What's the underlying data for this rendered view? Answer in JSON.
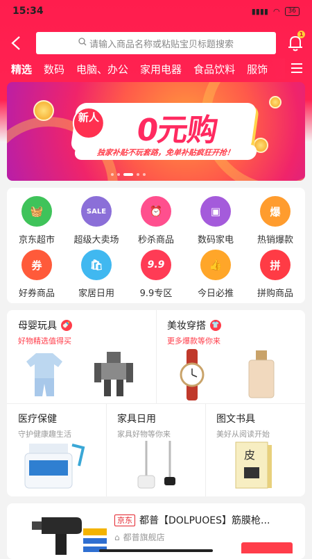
{
  "status": {
    "time": "15:34",
    "battery": "36"
  },
  "search": {
    "placeholder": "请输入商品名称或粘贴宝贝标题搜索",
    "notification_count": "1"
  },
  "tabs": [
    "精选",
    "数码",
    "电脑、办公",
    "家用电器",
    "食品饮料",
    "服饰"
  ],
  "banner": {
    "badge": "新人",
    "title": "0元购",
    "subtitle": "独家补贴不玩套路，免单补贴疯狂开抢！"
  },
  "categories": [
    {
      "label": "京东超市",
      "glyph": "🧺",
      "color": "#3fc35a"
    },
    {
      "label": "超级大卖场",
      "glyph": "SALE",
      "color": "#8b6fd8"
    },
    {
      "label": "秒杀商品",
      "glyph": "⏰",
      "color": "#ff4f8e"
    },
    {
      "label": "数码家电",
      "glyph": "▣",
      "color": "#a45bdb"
    },
    {
      "label": "热销爆款",
      "glyph": "爆",
      "color": "#ff9c2e"
    },
    {
      "label": "好券商品",
      "glyph": "券",
      "color": "#ff5a3a"
    },
    {
      "label": "家居日用",
      "glyph": "🛍",
      "color": "#40b8f0"
    },
    {
      "label": "9.9专区",
      "glyph": "9.9",
      "color": "#ff3b55"
    },
    {
      "label": "今日必推",
      "glyph": "👍",
      "color": "#ffa629"
    },
    {
      "label": "拼购商品",
      "glyph": "拼",
      "color": "#ff3b45"
    }
  ],
  "promos": {
    "baby": {
      "title": "母婴玩具",
      "subtitle": "好物精选值得买"
    },
    "beauty": {
      "title": "美妆穿搭",
      "subtitle": "更多爆款等你来"
    },
    "health": {
      "title": "医疗保健",
      "subtitle": "守护健康趣生活"
    },
    "furniture": {
      "title": "家具日用",
      "subtitle": "家具好物等你来"
    },
    "books": {
      "title": "图文书具",
      "subtitle": "美好从阅读开始"
    }
  },
  "product": {
    "tag": "京东",
    "title": "都普【DOLPUOES】筋膜枪...",
    "shop": "都普旗舰店"
  }
}
